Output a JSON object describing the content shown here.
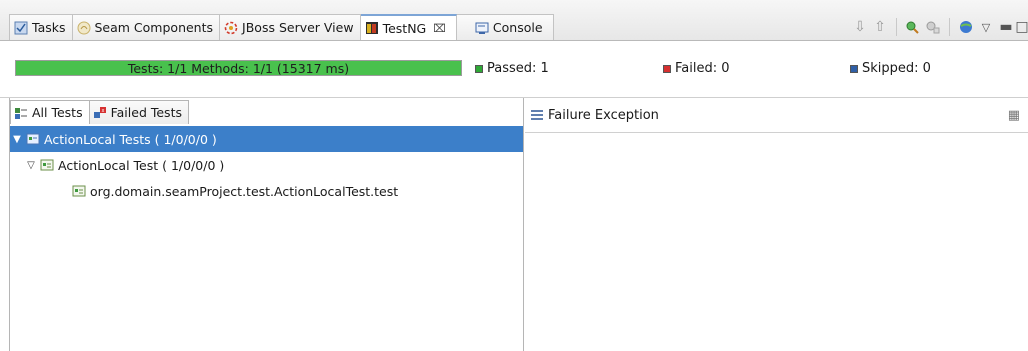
{
  "tabs": [
    {
      "label": "Tasks",
      "icon": "tasks-icon"
    },
    {
      "label": "Seam Components",
      "icon": "seam-components-icon"
    },
    {
      "label": "JBoss Server View",
      "icon": "jboss-server-icon"
    },
    {
      "label": "TestNG",
      "icon": "testng-icon",
      "active": true,
      "close": "⿸"
    },
    {
      "label": "Console",
      "icon": "console-icon"
    }
  ],
  "progress": {
    "text": "Tests: 1/1  Methods: 1/1 (15317 ms)",
    "fraction": 1.0,
    "color": "#49c14d"
  },
  "stats": {
    "passed": "Passed: 1",
    "failed": "Failed: 0",
    "skipped": "Skipped: 0",
    "passed_color": "#2ea836",
    "failed_color": "#d63030",
    "skipped_color": "#2f5fa6"
  },
  "subtabs": [
    {
      "label": "All Tests"
    },
    {
      "label": "Failed Tests"
    }
  ],
  "tree": [
    {
      "label": "ActionLocal Tests ( 1/0/0/0 )",
      "selected": true
    },
    {
      "label": "ActionLocal Test ( 1/0/0/0 )"
    },
    {
      "label": "org.domain.seamProject.test.ActionLocalTest.test"
    }
  ],
  "right": {
    "title": "Failure Exception"
  },
  "colors": {
    "selection": "#3c7fc9",
    "active_tab_border": "#7da5d6"
  }
}
